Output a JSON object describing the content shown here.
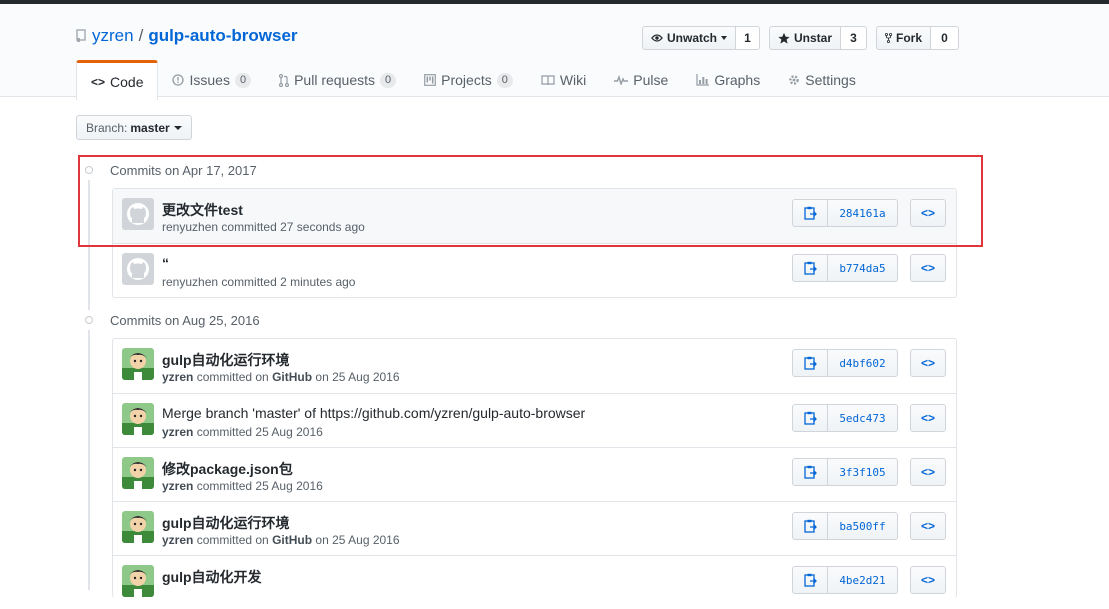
{
  "repo": {
    "owner": "yzren",
    "separator": "/",
    "name": "gulp-auto-browser"
  },
  "actions": {
    "watch": {
      "label": "Unwatch",
      "count": "1"
    },
    "star": {
      "label": "Unstar",
      "count": "3"
    },
    "fork": {
      "label": "Fork",
      "count": "0"
    }
  },
  "nav": {
    "code": "Code",
    "issues": {
      "label": "Issues",
      "count": "0"
    },
    "pulls": {
      "label": "Pull requests",
      "count": "0"
    },
    "projects": {
      "label": "Projects",
      "count": "0"
    },
    "wiki": "Wiki",
    "pulse": "Pulse",
    "graphs": "Graphs",
    "settings": "Settings"
  },
  "branch": {
    "label": "Branch:",
    "value": "master"
  },
  "groups": [
    {
      "title": "Commits on Apr 17, 2017",
      "commits": [
        {
          "message": "更改文件test",
          "author": "renyuzhen",
          "verb": "committed",
          "time": "27 seconds ago",
          "sha": "284161a"
        },
        {
          "message": "“",
          "author": "renyuzhen",
          "verb": "committed",
          "time": "2 minutes ago",
          "sha": "b774da5"
        }
      ]
    },
    {
      "title": "Commits on Aug 25, 2016",
      "commits": [
        {
          "message": "gulp自动化运行环境",
          "author": "yzren",
          "verb": "committed on",
          "via": "GitHub",
          "on": "on",
          "time": "25 Aug 2016",
          "sha": "d4bf602"
        },
        {
          "message": "Merge branch 'master' of https://github.com/yzren/gulp-auto-browser",
          "author": "yzren",
          "verb": "committed",
          "time": "25 Aug 2016",
          "sha": "5edc473"
        },
        {
          "message": "修改package.json包",
          "author": "yzren",
          "verb": "committed",
          "time": "25 Aug 2016",
          "sha": "3f3f105"
        },
        {
          "message": "gulp自动化运行环境",
          "author": "yzren",
          "verb": "committed on",
          "via": "GitHub",
          "on": "on",
          "time": "25 Aug 2016",
          "sha": "ba500ff"
        },
        {
          "message": "gulp自动化开发",
          "sha": "4be2d21"
        }
      ]
    }
  ],
  "colors": {
    "link": "#0366d6",
    "accent_tab": "#e36209",
    "annotation_box": "#e0353a"
  }
}
